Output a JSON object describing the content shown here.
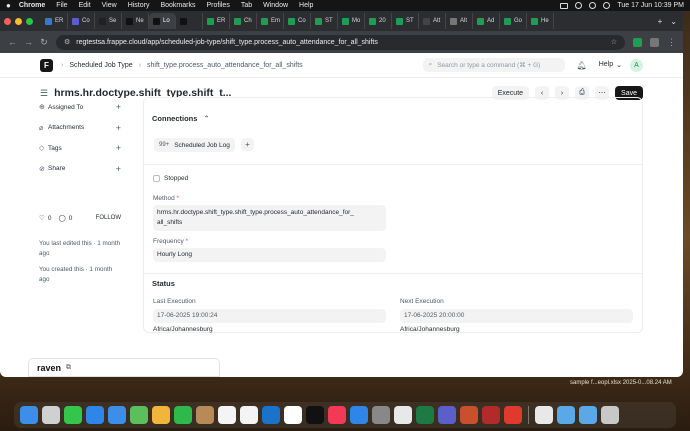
{
  "menubar": {
    "apple": "",
    "items": [
      "Chrome",
      "File",
      "Edit",
      "View",
      "History",
      "Bookmarks",
      "Profiles",
      "Tab",
      "Window",
      "Help"
    ],
    "datetime": "Tue 17 Jun  10:39 PM"
  },
  "browser": {
    "tabs": [
      {
        "label": "ER",
        "color": "#3b73d6"
      },
      {
        "label": "Co",
        "color": "#5b5bd6"
      },
      {
        "label": "Se",
        "color": "#222222"
      },
      {
        "label": "Ne",
        "color": "#111111"
      },
      {
        "label": "Lo",
        "color": "#111111"
      },
      {
        "label": "",
        "color": "#111111"
      },
      {
        "label": "ER",
        "color": "#1f9d55"
      },
      {
        "label": "Ch",
        "color": "#1f9d55"
      },
      {
        "label": "Em",
        "color": "#1f9d55"
      },
      {
        "label": "Co",
        "color": "#1f9d55"
      },
      {
        "label": "ST",
        "color": "#1f9d55"
      },
      {
        "label": "Mo",
        "color": "#1f9d55"
      },
      {
        "label": "20",
        "color": "#1f9d55"
      },
      {
        "label": "ST",
        "color": "#1f9d55"
      },
      {
        "label": "Att",
        "color": "#444444"
      },
      {
        "label": "Alt",
        "color": "#777777"
      },
      {
        "label": "Ad",
        "color": "#1f9d55"
      },
      {
        "label": "Go",
        "color": "#1f9d55"
      },
      {
        "label": "He",
        "color": "#1f9d55"
      }
    ],
    "url": "regtestsa.frappe.cloud/app/scheduled-job-type/shift_type.process_auto_attendance_for_all_shifts"
  },
  "navbar": {
    "logo": "F",
    "breadcrumb_doctype": "Scheduled Job Type",
    "breadcrumb_name": "shift_type.process_auto_attendance_for_all_shifts",
    "search_placeholder": "Search or type a command (⌘ + G)",
    "help": "Help",
    "avatar_initial": "A"
  },
  "page": {
    "title": "hrms.hr.doctype.shift_type.shift_t...",
    "execute_label": "Execute",
    "save_label": "Save"
  },
  "sidebar": {
    "items": [
      {
        "label": "Assigned To"
      },
      {
        "label": "Attachments"
      },
      {
        "label": "Tags"
      },
      {
        "label": "Share"
      }
    ],
    "likes": "0",
    "comments": "0",
    "follow": "FOLLOW",
    "last_edited": "You last edited this · 1 month ago",
    "created": "You created this · 1 month ago"
  },
  "form": {
    "connections_title": "Connections",
    "connection_count": "99+",
    "connection_label": "Scheduled Job Log",
    "stopped_label": "Stopped",
    "method_label": "Method",
    "method_value_line1": "hrms.hr.doctype.shift_type.shift_type.process_auto_attendance_for_",
    "method_value_line2": "all_shifts",
    "frequency_label": "Frequency",
    "frequency_value": "Hourly Long",
    "status_title": "Status",
    "last_execution_label": "Last Execution",
    "last_execution_value": "17-06-2025 19:00:24",
    "last_execution_tz": "Africa/Johannesburg",
    "next_execution_label": "Next Execution",
    "next_execution_value": "17-06-2025 20:00:00",
    "next_execution_tz": "Africa/Johannesburg"
  },
  "raven": {
    "name": "raven"
  },
  "desktop": {
    "file_label": "sample f...eopl.xlsx",
    "file_date": "2025-0...08.24 AM"
  },
  "dock": {
    "icons": [
      {
        "name": "finder",
        "color": "#3d8ee8"
      },
      {
        "name": "launchpad",
        "color": "#d0d0d0"
      },
      {
        "name": "messages",
        "color": "#36c54b"
      },
      {
        "name": "safari",
        "color": "#2f86e8"
      },
      {
        "name": "mail",
        "color": "#3d8ee8"
      },
      {
        "name": "maps",
        "color": "#5bbf5b"
      },
      {
        "name": "photos",
        "color": "#f2b53c"
      },
      {
        "name": "facetime",
        "color": "#2fb84b"
      },
      {
        "name": "contacts",
        "color": "#b88a5a"
      },
      {
        "name": "reminders",
        "color": "#f4f4f4"
      },
      {
        "name": "freeform",
        "color": "#f4f4f4"
      },
      {
        "name": "outlook",
        "color": "#1a73c9"
      },
      {
        "name": "calendar",
        "color": "#ffffff"
      },
      {
        "name": "tv",
        "color": "#111111"
      },
      {
        "name": "music",
        "color": "#f23a56"
      },
      {
        "name": "app-store",
        "color": "#2f86e8"
      },
      {
        "name": "settings",
        "color": "#888888"
      },
      {
        "name": "chrome",
        "color": "#e8e8e8"
      },
      {
        "name": "excel",
        "color": "#1e7a45"
      },
      {
        "name": "teams",
        "color": "#5b5fc7"
      },
      {
        "name": "powerpoint",
        "color": "#c8502e"
      },
      {
        "name": "dictionary",
        "color": "#b22a2a"
      },
      {
        "name": "anydesk",
        "color": "#e03a2f"
      },
      {
        "name": "preview",
        "color": "#e8e8e8"
      },
      {
        "name": "folder",
        "color": "#5aa8e8"
      },
      {
        "name": "folder",
        "color": "#5aa8e8"
      },
      {
        "name": "trash",
        "color": "#c8c8c8"
      }
    ]
  }
}
